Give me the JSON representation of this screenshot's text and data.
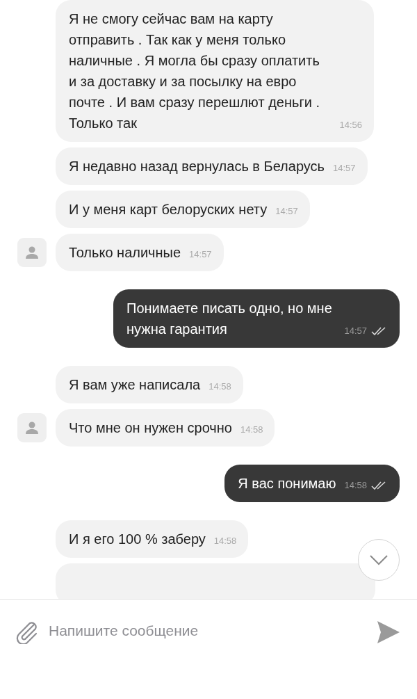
{
  "messages": [
    {
      "kind": "incoming",
      "avatar": false,
      "text": "Я не смогу сейчас вам на карту отправить . Так как у меня только наличные . Я могла бы сразу оплатить и за доставку и за посылку на евро почте . И вам сразу перешлют деньги . Только так",
      "time": "14:56"
    },
    {
      "kind": "incoming",
      "avatar": false,
      "text": "Я недавно назад вернулась в Беларусь",
      "time": "14:57"
    },
    {
      "kind": "incoming",
      "avatar": false,
      "text": "И у меня карт белоруских  нету",
      "time": "14:57"
    },
    {
      "kind": "incoming",
      "avatar": true,
      "text": "Только наличные",
      "time": "14:57"
    },
    {
      "kind": "outgoing",
      "read": true,
      "text": "Понимаете писать одно, но мне нужна гарантия",
      "time": "14:57"
    },
    {
      "kind": "incoming",
      "avatar": false,
      "text": "Я вам уже написала",
      "time": "14:58"
    },
    {
      "kind": "incoming",
      "avatar": true,
      "text": "Что мне он нужен срочно",
      "time": "14:58"
    },
    {
      "kind": "outgoing",
      "read": true,
      "text": "Я вас понимаю",
      "time": "14:58"
    },
    {
      "kind": "incoming",
      "avatar": false,
      "text": "И я его 100 % заберу",
      "time": "14:58"
    },
    {
      "kind": "cut"
    }
  ],
  "composer": {
    "placeholder": "Напишите сообщение"
  }
}
